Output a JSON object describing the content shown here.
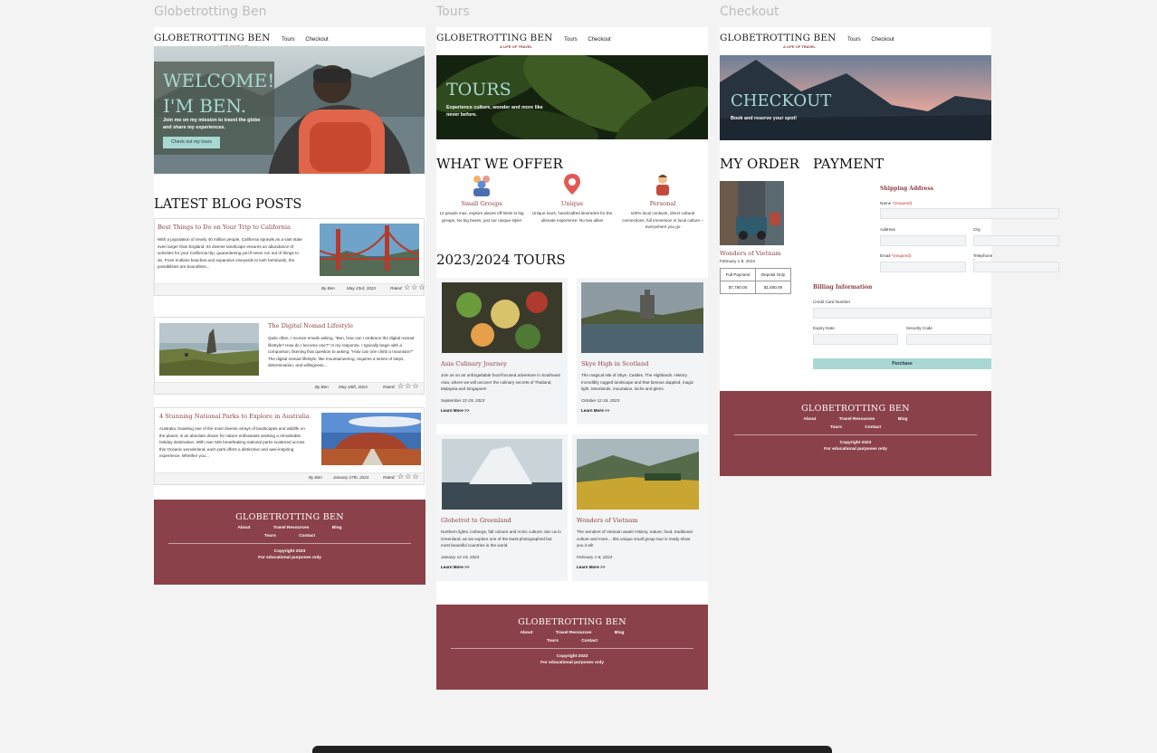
{
  "frames": {
    "home_label": "Globetrotting Ben",
    "tours_label": "Tours",
    "checkout_label": "Checkout"
  },
  "brand": {
    "logo": "GLOBETROTTING BEN",
    "tagline": "A LIFE OF TRAVEL",
    "nav_tours": "Tours",
    "nav_checkout": "Checkout"
  },
  "home": {
    "hero_line1": "WELCOME!",
    "hero_line2": "I'M BEN.",
    "hero_text": "Join me on my mission to travel the globe and share my experiences.",
    "hero_button": "Check out my tours",
    "section_title": "LATEST BLOG POSTS",
    "posts": [
      {
        "title": "Best Things to Do on Your Trip to California",
        "excerpt": "With a population of nearly 40 million people, California sprawls as a vast state even larger than England. Its diverse landscape ensures an abundance of activities for your California trip, guaranteeing you'll never run out of things to do. From endless beaches and expansive vineyards to lush farmlands, the possibilities are boundless...",
        "by": "By Ben",
        "date": "May 23rd, 2023",
        "rated": "Rated:"
      },
      {
        "title": "The Digital Nomad Lifestyle",
        "excerpt": "Quite often, I receive emails asking, \"Ben, how can I embrace the digital nomad lifestyle? How do I become one?\" In my response, I typically begin with a comparison, likening that question to asking, \"How can one climb a mountain?\" The digital nomad lifestyle, like mountaineering, requires a series of steps, determination, and willingness...",
        "by": "By Ben",
        "date": "May 18th, 2023",
        "rated": "Rated:"
      },
      {
        "title": "4 Stunning National Parks to Explore in Australia",
        "excerpt": "Australia, boasting one of the most diverse arrays of landscapes and wildlife on the planet, is an absolute dream for nature enthusiasts seeking a remarkable holiday destination. With over 500 breathtaking national parks scattered across this Oceanic wonderland, each park offers a distinctive and awe-inspiring experience. Whether you...",
        "by": "By Ben",
        "date": "January 27th, 2023",
        "rated": "Rated:"
      }
    ],
    "stars": "☆☆☆"
  },
  "tours": {
    "hero_title": "TOURS",
    "hero_text": "Experience culture, wonder and more like never before.",
    "offer_title": "WHAT WE OFFER",
    "offers": [
      {
        "title": "Small Groups",
        "text": "12 people max, explore places off-limits to big groups. No big buses, just our unique style!"
      },
      {
        "title": "Unique",
        "text": "Unique tours, handcrafted itineraries for the ultimate experience. No two alike!"
      },
      {
        "title": "Personal",
        "text": "100% local contacts, direct cultural connections, full immersion in local culture – everywhere you go"
      }
    ],
    "list_title": "2023/2024 TOURS",
    "cards": [
      {
        "title": "Asia Culinary Journey",
        "text": "Join us on an unforgettable food-focused adventure in Southeast Asia, where we will uncover the culinary secrets of Thailand, Malaysia and Singapore!",
        "date": "September 22-29, 2023",
        "link": "Learn More >>"
      },
      {
        "title": "Skye High in Scotland",
        "text": "The magical Isle of Skye. Castles. The Highlands. History. Incredibly rugged landscape and that famous dappled, magic light. Moorlands, mountains, lochs and glens.",
        "date": "October 12-18, 2023",
        "link": "Learn More >>"
      },
      {
        "title": "Globetrot to Greenland",
        "text": "Northern lights, icebergs, fall colours and Arctic culture! Join us in Greenland, as we explore one of the least-photographed but most beautiful countries in the world.",
        "date": "January 12-19, 2024",
        "link": "Learn More >>"
      },
      {
        "title": "Wonders of Vietnam",
        "text": "The wonders of Vietnam await! History, nature, food, traditional culture and more... this unique small group tour is ready show you it all!",
        "date": "February 1-8, 2024",
        "link": "Learn More >>"
      }
    ]
  },
  "checkout": {
    "hero_title": "CHECKOUT",
    "hero_text": "Book and reserve your spot!",
    "order_title": "MY ORDER",
    "payment_title": "PAYMENT",
    "item_title": "Wonders of Vietnam",
    "item_date": "February 1-8, 2024",
    "col_full": "Full Payment",
    "col_deposit": "Deposit Only",
    "price_full": "$7,750.00",
    "price_deposit": "$1,500.00",
    "shipping_title": "Shipping Address",
    "name_label": "Name",
    "required": "*(required)",
    "address_label": "Address",
    "city_label": "City",
    "email_label": "Email",
    "telephone_label": "Telephone",
    "billing_title": "Billing Information",
    "card_label": "Credit Card Number",
    "expiry_label": "Expiry Date",
    "security_label": "Security Code",
    "purchase": "Purchase"
  },
  "footer": {
    "title": "GLOBETROTTING BEN",
    "about": "About",
    "resources": "Travel Resources",
    "blog": "Blog",
    "tours": "Tours",
    "contact": "Contact",
    "copyright": "Copyright 2023",
    "note": "For educational purposes only"
  },
  "colors": {
    "brand": "#8b4149",
    "accent": "#a9d8d2",
    "page": "#f3f3f3"
  }
}
